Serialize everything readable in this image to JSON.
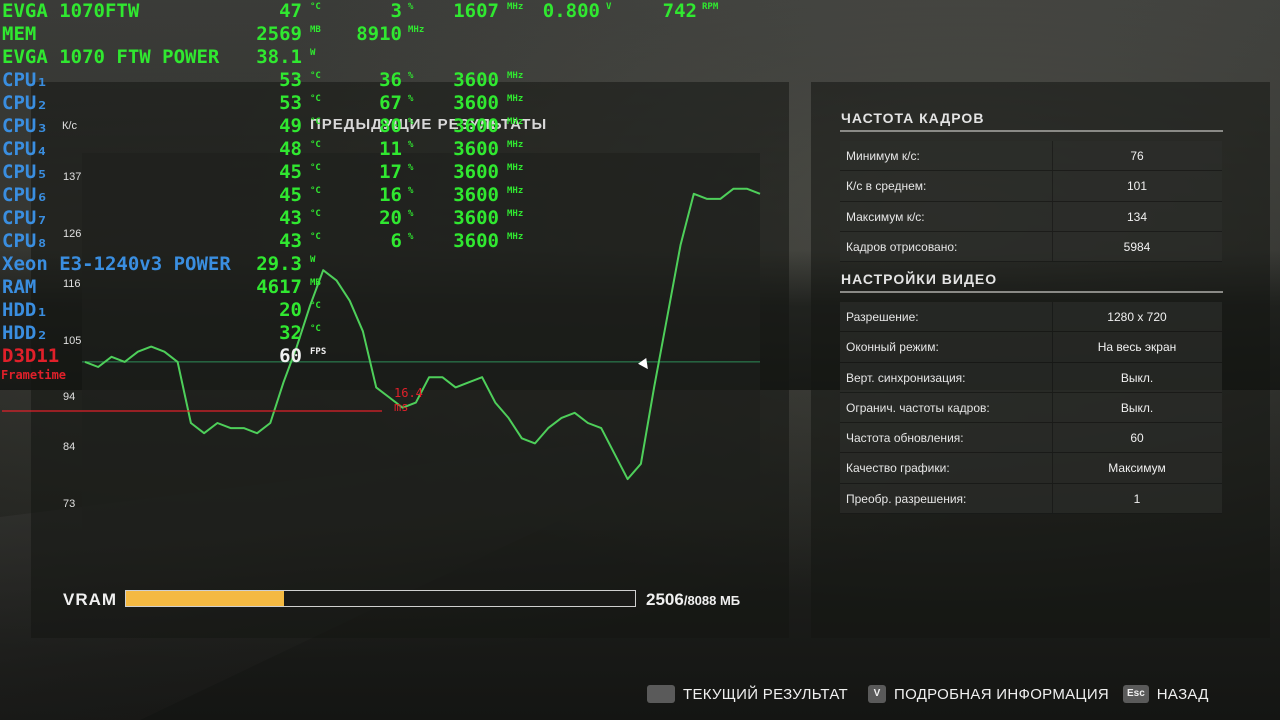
{
  "osd": {
    "gpu": {
      "label": "EVGA 1070FTW",
      "temp": "47",
      "temp_unit": "°C",
      "load": "3",
      "load_unit": "%",
      "clock": "1607",
      "clock_unit": "MHz",
      "voltage": "0.800",
      "voltage_unit": "V",
      "fan": "742",
      "fan_unit": "RPM"
    },
    "mem": {
      "label": "MEM",
      "used": "2569",
      "used_unit": "MB",
      "clock": "8910",
      "clock_unit": "MHz"
    },
    "gpu_power": {
      "label": "EVGA 1070 FTW POWER",
      "value": "38.1",
      "unit": "W"
    },
    "cpus": [
      {
        "label": "CPU₁",
        "temp": "53",
        "load": "36",
        "clock": "3600"
      },
      {
        "label": "CPU₂",
        "temp": "53",
        "load": "67",
        "clock": "3600"
      },
      {
        "label": "CPU₃",
        "temp": "49",
        "load": "80",
        "clock": "3600"
      },
      {
        "label": "CPU₄",
        "temp": "48",
        "load": "11",
        "clock": "3600"
      },
      {
        "label": "CPU₅",
        "temp": "45",
        "load": "17",
        "clock": "3600"
      },
      {
        "label": "CPU₆",
        "temp": "45",
        "load": "16",
        "clock": "3600"
      },
      {
        "label": "CPU₇",
        "temp": "43",
        "load": "20",
        "clock": "3600"
      },
      {
        "label": "CPU₈",
        "temp": "43",
        "load": "6",
        "clock": "3600"
      }
    ],
    "cpu_units": {
      "temp": "°C",
      "load": "%",
      "clock": "MHz"
    },
    "cpu_power": {
      "label": "Xeon E3-1240v3 POWER",
      "value": "29.3",
      "unit": "W"
    },
    "ram": {
      "label": "RAM",
      "value": "4617",
      "unit": "MB"
    },
    "hdd1": {
      "label": "HDD₁",
      "value": "20",
      "unit": "°C"
    },
    "hdd2": {
      "label": "HDD₂",
      "value": "32",
      "unit": "°C"
    },
    "d3d": {
      "label": "D3D11",
      "value": "60",
      "unit": "FPS"
    },
    "frametime": {
      "label": "Frametime",
      "value": "16.4 ms"
    }
  },
  "chart_data": {
    "type": "line",
    "title": "ПРЕДЫДУЩИЕ РЕЗУЛЬТАТЫ",
    "ylabel": "К/с",
    "yticks": [
      137,
      126,
      116,
      105,
      94,
      84,
      73
    ],
    "ylim": [
      68,
      142
    ],
    "reference_line": 101,
    "grid": false,
    "series": [
      {
        "values": [
          101,
          100,
          102,
          101,
          103,
          104,
          103,
          101,
          89,
          87,
          89,
          88,
          88,
          87,
          89,
          97,
          104,
          112,
          119,
          117,
          113,
          107,
          96,
          94,
          92,
          93,
          98,
          98,
          96,
          97,
          98,
          93,
          90,
          86,
          85,
          88,
          90,
          91,
          89,
          88,
          83,
          78,
          81,
          96,
          110,
          124,
          134,
          133,
          133,
          135,
          135,
          134
        ]
      }
    ],
    "colors": {
      "line": "#4ecf5a",
      "reference": "#2e8b57"
    }
  },
  "vram": {
    "label": "VRAM",
    "used": "2506",
    "total": "/8088 МБ",
    "fraction": 0.31
  },
  "frame_rate": {
    "title": "ЧАСТОТА КАДРОВ",
    "rows": [
      {
        "key": "Минимум к/с:",
        "value": "76"
      },
      {
        "key": "К/с в среднем:",
        "value": "101"
      },
      {
        "key": "Максимум к/с:",
        "value": "134"
      },
      {
        "key": "Кадров отрисовано:",
        "value": "5984"
      }
    ]
  },
  "video_settings": {
    "title": "НАСТРОЙКИ ВИДЕО",
    "rows": [
      {
        "key": "Разрешение:",
        "value": "1280 x 720"
      },
      {
        "key": "Оконный режим:",
        "value": "На весь экран"
      },
      {
        "key": "Верт. синхронизация:",
        "value": "Выкл."
      },
      {
        "key": "Огранич. частоты кадров:",
        "value": "Выкл."
      },
      {
        "key": "Частота обновления:",
        "value": "60"
      },
      {
        "key": "Качество графики:",
        "value": "Максимум"
      },
      {
        "key": "Преобр. разрешения:",
        "value": "1"
      }
    ]
  },
  "footer": {
    "current_key": "",
    "current_label": "ТЕКУЩИЙ РЕЗУЛЬТАТ",
    "details_key": "V",
    "details_label": "ПОДРОБНАЯ ИНФОРМАЦИЯ",
    "back_key": "Esc",
    "back_label": "НАЗАД"
  }
}
